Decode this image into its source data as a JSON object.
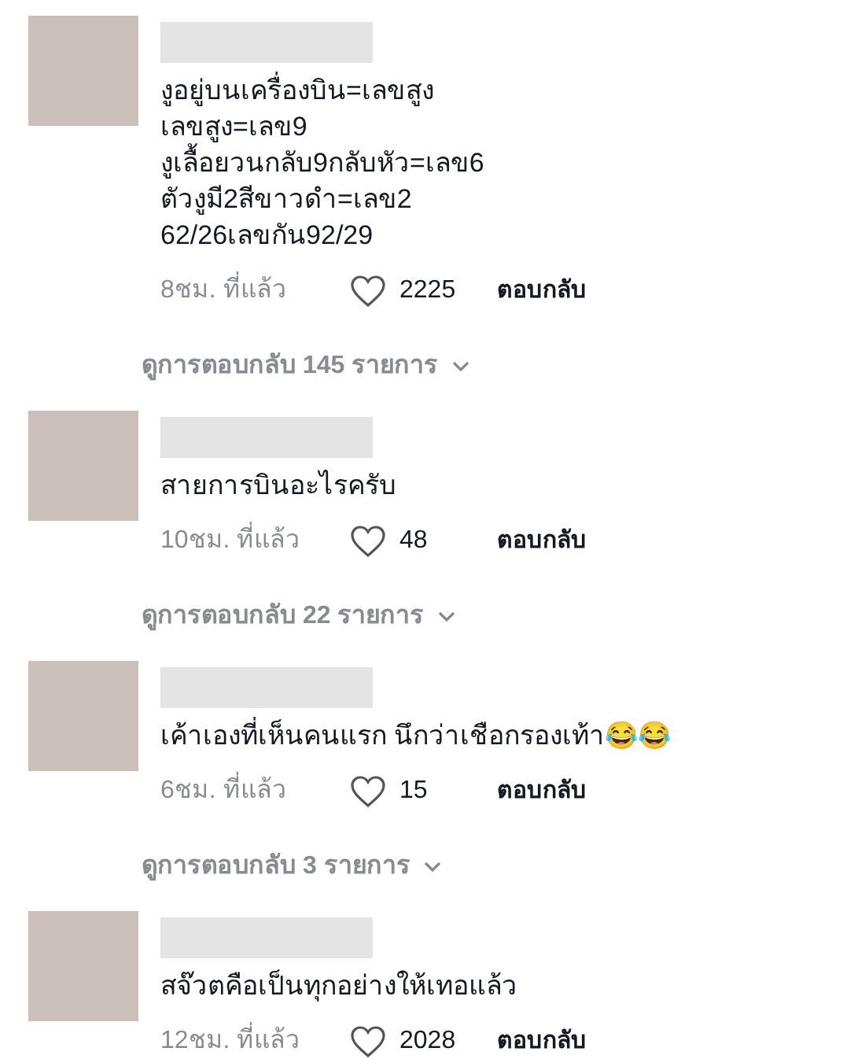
{
  "comments": [
    {
      "text_lines": [
        "งูอยู่บนเครื่องบิน=เลขสูง",
        "เลขสูง=เลข9",
        "งูเลื้อยวนกลับ9กลับหัว=เลข6",
        "ตัวงูมี2สีขาวดำ=เลข2",
        "62/26เลขกัน92/29"
      ],
      "time": "8ชม. ที่แล้ว",
      "likes": "2225",
      "reply": "ตอบกลับ",
      "view_replies": "ดูการตอบกลับ 145 รายการ"
    },
    {
      "text_lines": [
        "สายการบินอะไรครับ"
      ],
      "time": "10ชม. ที่แล้ว",
      "likes": "48",
      "reply": "ตอบกลับ",
      "view_replies": "ดูการตอบกลับ 22 รายการ"
    },
    {
      "text_lines": [
        "เค้าเองที่เห็นคนแรก นึกว่าเชือกรองเท้า😂😂"
      ],
      "time": "6ชม. ที่แล้ว",
      "likes": "15",
      "reply": "ตอบกลับ",
      "view_replies": "ดูการตอบกลับ 3 รายการ"
    },
    {
      "text_lines": [
        "สจ๊วตคือเป็นทุกอย่างให้เทอแล้ว"
      ],
      "time": "12ชม. ที่แล้ว",
      "likes": "2028",
      "reply": "ตอบกลับ"
    }
  ]
}
